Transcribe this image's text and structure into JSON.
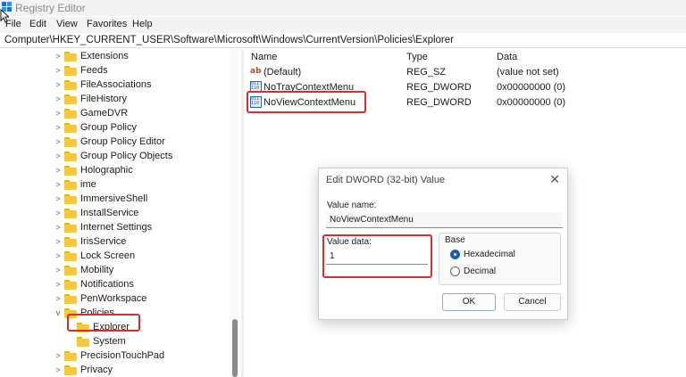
{
  "window": {
    "title": "Registry Editor"
  },
  "menu": [
    "File",
    "Edit",
    "View",
    "Favorites",
    "Help"
  ],
  "address": "Computer\\HKEY_CURRENT_USER\\Software\\Microsoft\\Windows\\CurrentVersion\\Policies\\Explorer",
  "tree": {
    "items": [
      {
        "label": "Extensions",
        "expander": ">"
      },
      {
        "label": "Feeds",
        "expander": ">"
      },
      {
        "label": "FileAssociations",
        "expander": ">"
      },
      {
        "label": "FileHistory",
        "expander": ">"
      },
      {
        "label": "GameDVR",
        "expander": ">"
      },
      {
        "label": "Group Policy",
        "expander": ">"
      },
      {
        "label": "Group Policy Editor",
        "expander": ">"
      },
      {
        "label": "Group Policy Objects",
        "expander": ">"
      },
      {
        "label": "Holographic",
        "expander": ">"
      },
      {
        "label": "ime",
        "expander": ">"
      },
      {
        "label": "ImmersiveShell",
        "expander": ">"
      },
      {
        "label": "InstallService",
        "expander": ">"
      },
      {
        "label": "Internet Settings",
        "expander": ">"
      },
      {
        "label": "IrisService",
        "expander": ">"
      },
      {
        "label": "Lock Screen",
        "expander": ">"
      },
      {
        "label": "Mobility",
        "expander": ">"
      },
      {
        "label": "Notifications",
        "expander": ">"
      },
      {
        "label": "PenWorkspace",
        "expander": ">"
      },
      {
        "label": "Policies",
        "expander": "v"
      },
      {
        "label": "Explorer",
        "expander": ""
      },
      {
        "label": "System",
        "expander": ""
      },
      {
        "label": "PrecisionTouchPad",
        "expander": ">"
      },
      {
        "label": "Privacy",
        "expander": ">"
      }
    ]
  },
  "list": {
    "headers": {
      "name": "Name",
      "type": "Type",
      "data": "Data"
    },
    "rows": [
      {
        "name": "(Default)",
        "type": "REG_SZ",
        "data": "(value not set)",
        "icon": "string-value-icon"
      },
      {
        "name": "NoTrayContextMenu",
        "type": "REG_DWORD",
        "data": "0x00000000 (0)",
        "icon": "binary-value-icon"
      },
      {
        "name": "NoViewContextMenu",
        "type": "REG_DWORD",
        "data": "0x00000000 (0)",
        "icon": "binary-value-icon"
      }
    ]
  },
  "dialog": {
    "title": "Edit DWORD (32-bit) Value",
    "close": "✕",
    "value_name_label": "Value name:",
    "value_name": "NoViewContextMenu",
    "value_data_label": "Value data:",
    "value_data": "1",
    "base_label": "Base",
    "hex_label": "Hexadecimal",
    "dec_label": "Decimal",
    "ok": "OK",
    "cancel": "Cancel"
  },
  "colors": {
    "highlight": "#d62e2e",
    "accent": "#1b5fb4",
    "folder": "#f5c842"
  }
}
